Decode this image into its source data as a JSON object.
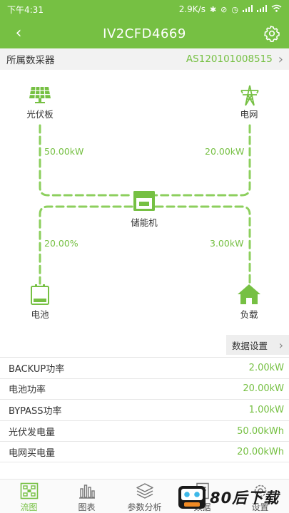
{
  "status_bar": {
    "time": "下午4:31",
    "net_speed": "2.9K/s",
    "icons": [
      "bluetooth-icon",
      "mute-icon",
      "alarm-icon",
      "signal-icon",
      "signal-icon",
      "wifi-icon"
    ]
  },
  "header": {
    "title": "IV2CFD4669",
    "back_icon": "chevron-left-icon",
    "settings_icon": "gear-icon"
  },
  "collector": {
    "label": "所属数采器",
    "value": "AS120101008515"
  },
  "diagram": {
    "pv": {
      "label": "光伏板",
      "icon": "solar-panel-icon",
      "power": "50.00kW"
    },
    "grid": {
      "label": "电网",
      "icon": "power-tower-icon",
      "power": "20.00kW"
    },
    "storage": {
      "label": "储能机",
      "icon": "inverter-icon"
    },
    "battery": {
      "label": "电池",
      "icon": "battery-icon",
      "soc": "20.00%"
    },
    "load": {
      "label": "负载",
      "icon": "house-icon",
      "power": "3.00kW"
    }
  },
  "data_settings": {
    "label": "数据设置"
  },
  "params": [
    {
      "name": "BACKUP功率",
      "value": "2.00kW"
    },
    {
      "name": "电池功率",
      "value": "20.00kW"
    },
    {
      "name": "BYPASS功率",
      "value": "1.00kW"
    },
    {
      "name": "光伏发电量",
      "value": "50.00kWh"
    },
    {
      "name": "电网买电量",
      "value": "20.00kWh"
    }
  ],
  "tabs": [
    {
      "label": "流图",
      "icon": "flow-diagram-icon",
      "active": true
    },
    {
      "label": "图表",
      "icon": "bar-chart-icon",
      "active": false
    },
    {
      "label": "参数分析",
      "icon": "layers-icon",
      "active": false
    },
    {
      "label": "数据",
      "icon": "document-icon",
      "active": false
    },
    {
      "label": "设置",
      "icon": "gear-icon",
      "active": false
    }
  ],
  "watermark": {
    "text": "80后下载"
  },
  "colors": {
    "accent": "#76c043",
    "flow_line": "#8ccf5d"
  }
}
